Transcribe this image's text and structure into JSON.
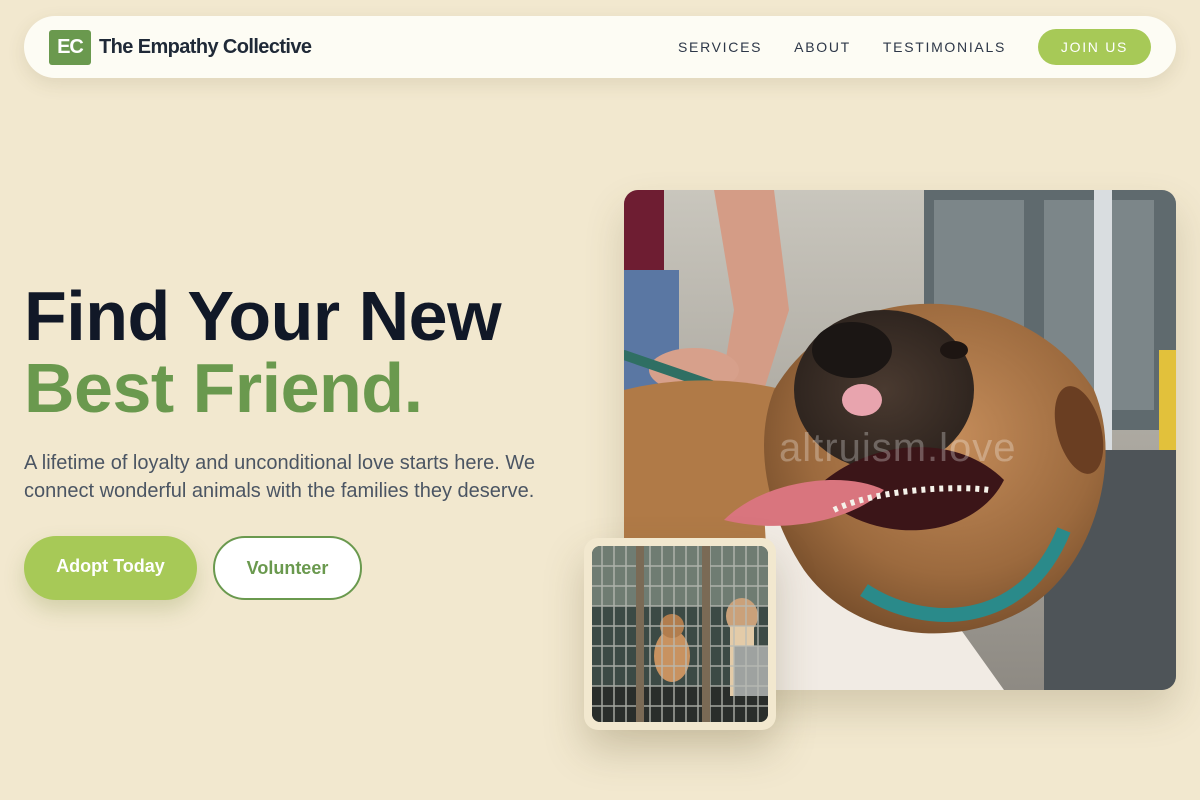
{
  "nav": {
    "logo_initials": "EC",
    "brand": "The Empathy Collective",
    "links": [
      "SERVICES",
      "ABOUT",
      "TESTIMONIALS"
    ],
    "cta": "JOIN US"
  },
  "hero": {
    "headline_line1": "Find Your New",
    "headline_line2": "Best Friend.",
    "subtitle": "A lifetime of loyalty and unconditional love starts here. We connect wonderful animals with the families they deserve.",
    "primary_button": "Adopt Today",
    "secondary_button": "Volunteer"
  },
  "images": {
    "main_watermark": "altruism.love",
    "main_description_icon": "dog-photo",
    "secondary_description_icon": "kennel-dogs-photo"
  },
  "colors": {
    "background": "#f2e8cf",
    "accent_dark": "#6a994e",
    "accent_light": "#a7c957",
    "text_dark": "#111827"
  }
}
